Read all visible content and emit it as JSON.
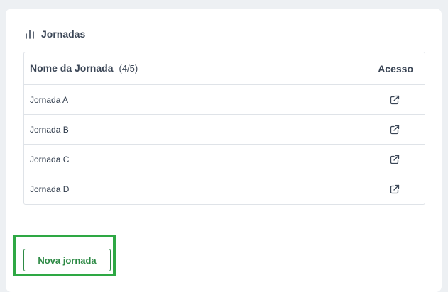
{
  "section": {
    "title": "Jornadas",
    "icon": "bar-chart-icon"
  },
  "table": {
    "header": {
      "name_label": "Nome da Jornada",
      "count": "(4/5)",
      "access_label": "Acesso"
    },
    "rows": [
      {
        "name": "Jornada A",
        "action_icon": "external-link-icon"
      },
      {
        "name": "Jornada B",
        "action_icon": "external-link-icon"
      },
      {
        "name": "Jornada C",
        "action_icon": "external-link-icon"
      },
      {
        "name": "Jornada D",
        "action_icon": "external-link-icon"
      }
    ]
  },
  "actions": {
    "new_journey_label": "Nova jornada"
  },
  "colors": {
    "accent_green": "#2d8a45",
    "highlight_green": "#2ea844",
    "page_background": "#edf0f3",
    "card_background": "#ffffff",
    "text_primary": "#2f3b4b",
    "border": "#dfe3e8"
  }
}
